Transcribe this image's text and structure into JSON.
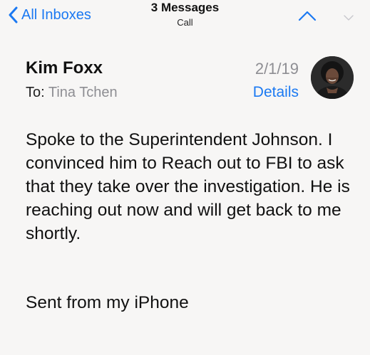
{
  "navbar": {
    "back_label": "All Inboxes",
    "title": "3 Messages",
    "subtitle": "Call"
  },
  "message": {
    "sender": "Kim Foxx",
    "to_label": "To:",
    "recipient": "Tina Tchen",
    "date": "2/1/19",
    "details_label": "Details",
    "body": "Spoke to the Superintendent Johnson. I convinced him to Reach out to FBI to ask that they take over the investigation. He is reaching out now and will get back to me shortly.",
    "signature": "Sent from my iPhone"
  },
  "icons": {
    "back": "chevron-left-icon",
    "previous": "chevron-up-icon",
    "next": "chevron-down-icon"
  },
  "colors": {
    "accent": "#1b79f2",
    "secondary_text": "#8e8e93",
    "background": "#f7f6f5"
  }
}
